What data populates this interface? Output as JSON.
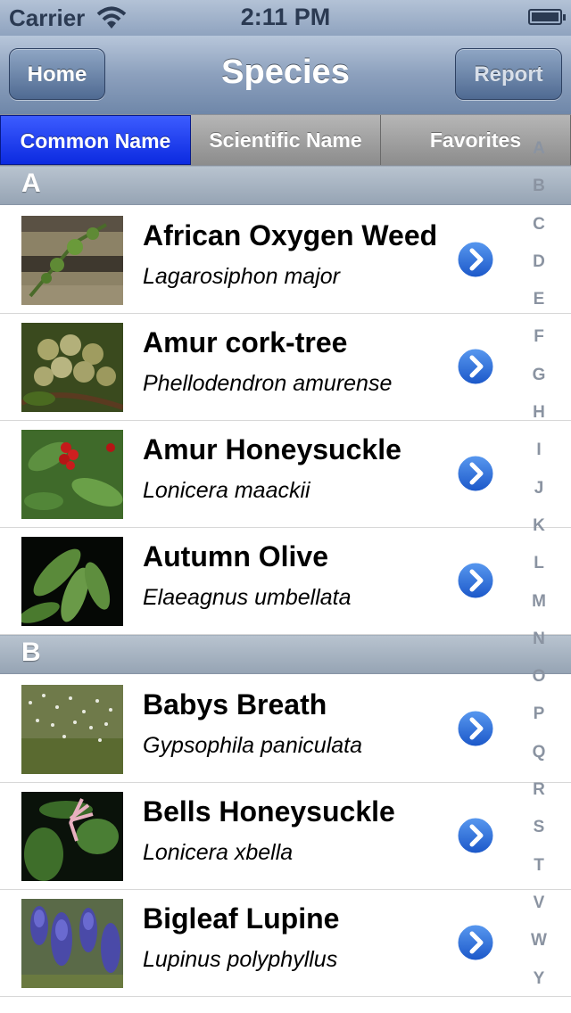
{
  "status": {
    "carrier": "Carrier",
    "time": "2:11 PM"
  },
  "nav": {
    "home": "Home",
    "title": "Species",
    "report": "Report"
  },
  "segments": [
    "Common Name",
    "Scientific Name",
    "Favorites"
  ],
  "sections": [
    {
      "letter": "A",
      "rows": [
        {
          "name": "African Oxygen Weed",
          "sci": "Lagarosiphon major",
          "thumb_icon": "plant-sprig-photo"
        },
        {
          "name": "Amur cork-tree",
          "sci": "Phellodendron amurense",
          "thumb_icon": "green-berries-photo"
        },
        {
          "name": "Amur Honeysuckle",
          "sci": "Lonicera maackii",
          "thumb_icon": "red-berries-photo"
        },
        {
          "name": "Autumn Olive",
          "sci": "Elaeagnus umbellata",
          "thumb_icon": "leaves-dark-photo"
        }
      ]
    },
    {
      "letter": "B",
      "rows": [
        {
          "name": "Babys Breath",
          "sci": "Gypsophila paniculata",
          "thumb_icon": "white-flowers-field-photo"
        },
        {
          "name": "Bells Honeysuckle",
          "sci": "Lonicera xbella",
          "thumb_icon": "pink-flower-leaves-photo"
        },
        {
          "name": "Bigleaf Lupine",
          "sci": "Lupinus polyphyllus",
          "thumb_icon": "purple-lupine-photo"
        }
      ]
    }
  ],
  "index_letters": [
    "A",
    "B",
    "C",
    "D",
    "E",
    "F",
    "G",
    "H",
    "I",
    "J",
    "K",
    "L",
    "M",
    "N",
    "O",
    "P",
    "Q",
    "R",
    "S",
    "T",
    "V",
    "W",
    "Y"
  ],
  "colors": {
    "segment_active": "#1a37f0",
    "navbar": "#8ca0bd",
    "section_header": "#a9b5c3",
    "disclosure": "#2a6ad6"
  }
}
